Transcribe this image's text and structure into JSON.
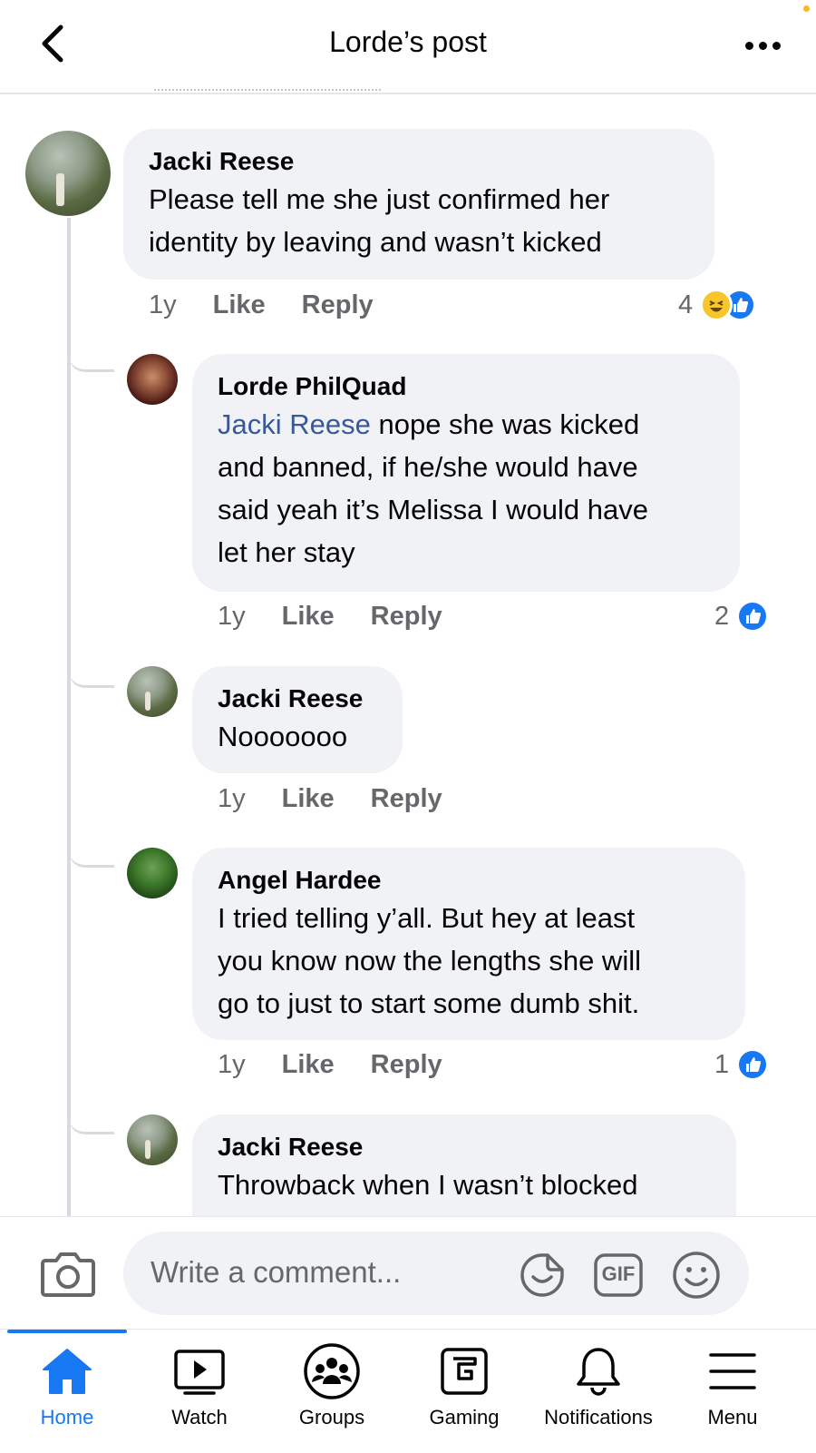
{
  "header": {
    "title": "Lorde’s post"
  },
  "comments": [
    {
      "author": "Jacki Reese",
      "text": "Please tell me she just confirmed her\nidentity by leaving and wasn’t kicked",
      "time": "1y",
      "like_label": "Like",
      "reply_label": "Reply",
      "reaction_count": "4"
    }
  ],
  "replies": [
    {
      "author": "Lorde PhilQuad",
      "mention": "Jacki Reese",
      "text": " nope she was kicked\nand banned, if he/she would have\nsaid yeah it’s Melissa I would have\nlet her stay",
      "time": "1y",
      "like_label": "Like",
      "reply_label": "Reply",
      "reaction_count": "2"
    },
    {
      "author": "Jacki Reese",
      "text": "Nooooooo",
      "time": "1y",
      "like_label": "Like",
      "reply_label": "Reply"
    },
    {
      "author": "Angel Hardee",
      "text": "I tried telling y’all. But hey at least\nyou know now the lengths she will\ngo to just to start some dumb shit.",
      "time": "1y",
      "like_label": "Like",
      "reply_label": "Reply",
      "reaction_count": "1"
    },
    {
      "author": "Jacki Reese",
      "text": "Throwback when I wasn’t blocked"
    }
  ],
  "composer": {
    "placeholder": "Write a comment...",
    "gif_label": "GIF"
  },
  "nav": {
    "items": [
      {
        "label": "Home",
        "icon": "home-icon"
      },
      {
        "label": "Watch",
        "icon": "watch-icon"
      },
      {
        "label": "Groups",
        "icon": "groups-icon"
      },
      {
        "label": "Gaming",
        "icon": "gaming-icon"
      },
      {
        "label": "Notifications",
        "icon": "bell-icon"
      },
      {
        "label": "Menu",
        "icon": "menu-icon"
      }
    ]
  },
  "colors": {
    "accent": "#1877f2",
    "bubble": "#f0f2f5",
    "mention": "#385898",
    "muted": "#65676b"
  }
}
